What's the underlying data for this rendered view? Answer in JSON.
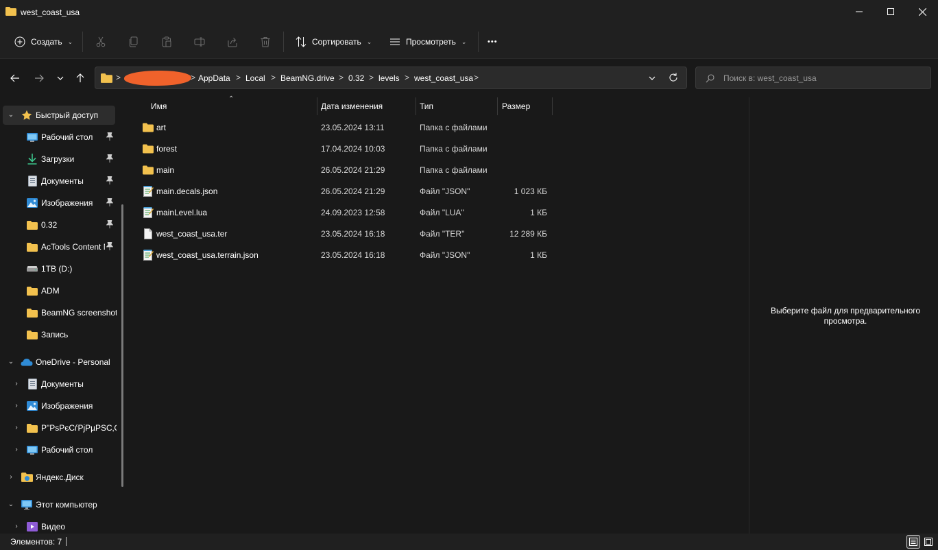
{
  "window": {
    "title": "west_coast_usa",
    "minimize_glyph": "—",
    "maximize_glyph": "☐",
    "close_glyph": "✕"
  },
  "toolbar": {
    "create_label": "Создать",
    "sort_label": "Сортировать",
    "view_label": "Просмотреть",
    "more_glyph": "•••",
    "icons": [
      "cut-icon",
      "copy-icon",
      "paste-icon",
      "rename-icon",
      "share-icon",
      "delete-icon"
    ]
  },
  "address": {
    "crumbs": [
      "AppData",
      "Local",
      "BeamNG.drive",
      "0.32",
      "levels",
      "west_coast_usa"
    ],
    "separator": ">"
  },
  "search": {
    "placeholder": "Поиск в: west_coast_usa"
  },
  "sidebar": {
    "quick_access": "Быстрый доступ",
    "quick_items": [
      {
        "label": "Рабочий стол",
        "icon": "desktop-icon",
        "pinned": true
      },
      {
        "label": "Загрузки",
        "icon": "download-icon",
        "pinned": true
      },
      {
        "label": "Документы",
        "icon": "document-icon",
        "pinned": true
      },
      {
        "label": "Изображения",
        "icon": "image-icon",
        "pinned": true
      },
      {
        "label": "0.32",
        "icon": "folder-icon",
        "pinned": true
      },
      {
        "label": "AcTools Content M",
        "icon": "folder-icon",
        "pinned": true
      },
      {
        "label": "1TB (D:)",
        "icon": "drive-icon",
        "pinned": false
      },
      {
        "label": "ADM",
        "icon": "folder-icon",
        "pinned": false
      },
      {
        "label": "BeamNG screenshots",
        "icon": "folder-icon",
        "pinned": false
      },
      {
        "label": "Запись",
        "icon": "folder-icon",
        "pinned": false
      }
    ],
    "onedrive": "OneDrive - Personal",
    "onedrive_items": [
      {
        "label": "Документы",
        "icon": "document-icon"
      },
      {
        "label": "Изображения",
        "icon": "image-icon"
      },
      {
        "label": "Р\"РѕРєСѓРјРµРЅС‚С‹",
        "icon": "folder-icon"
      },
      {
        "label": "Рабочий стол",
        "icon": "desktop-icon"
      }
    ],
    "yandex": "Яндекс.Диск",
    "this_pc": "Этот компьютер",
    "video": "Видео",
    "pin_glyph": "📌"
  },
  "columns": {
    "name": "Имя",
    "date": "Дата изменения",
    "type": "Тип",
    "size": "Размер"
  },
  "files": [
    {
      "name": "art",
      "date": "23.05.2024 13:11",
      "type": "Папка с файлами",
      "size": "",
      "icon": "folder-icon"
    },
    {
      "name": "forest",
      "date": "17.04.2024 10:03",
      "type": "Папка с файлами",
      "size": "",
      "icon": "folder-icon"
    },
    {
      "name": "main",
      "date": "26.05.2024 21:29",
      "type": "Папка с файлами",
      "size": "",
      "icon": "folder-icon"
    },
    {
      "name": "main.decals.json",
      "date": "26.05.2024 21:29",
      "type": "Файл \"JSON\"",
      "size": "1 023 КБ",
      "icon": "notepad-file-icon"
    },
    {
      "name": "mainLevel.lua",
      "date": "24.09.2023 12:58",
      "type": "Файл \"LUA\"",
      "size": "1 КБ",
      "icon": "notepad-file-icon"
    },
    {
      "name": "west_coast_usa.ter",
      "date": "23.05.2024 16:18",
      "type": "Файл \"TER\"",
      "size": "12 289 КБ",
      "icon": "blank-file-icon"
    },
    {
      "name": "west_coast_usa.terrain.json",
      "date": "23.05.2024 16:18",
      "type": "Файл \"JSON\"",
      "size": "1 КБ",
      "icon": "notepad-file-icon"
    }
  ],
  "preview": {
    "message": "Выберите файл для предварительного просмотра."
  },
  "status": {
    "items_count": "Элементов: 7"
  },
  "colors": {
    "folder": "#f2c14e",
    "accent": "#60cdff",
    "redaction": "#f0622b"
  }
}
